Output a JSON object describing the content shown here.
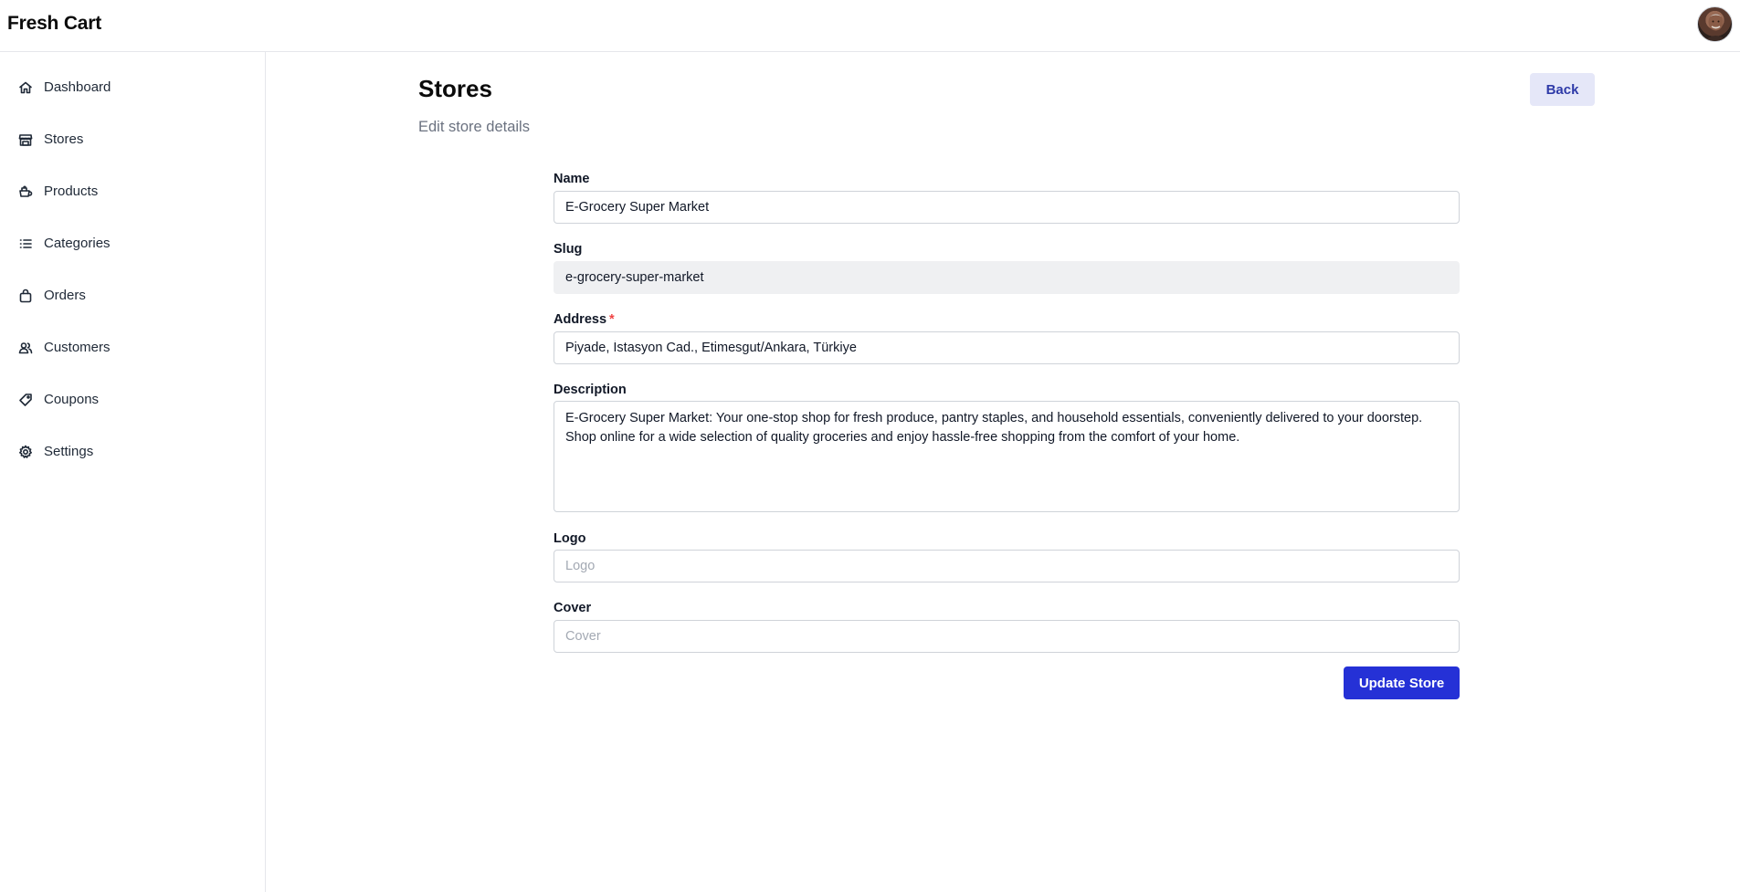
{
  "app": {
    "brand": "Fresh Cart"
  },
  "sidebar": {
    "items": [
      {
        "label": "Dashboard",
        "icon": "home-icon"
      },
      {
        "label": "Stores",
        "icon": "store-icon"
      },
      {
        "label": "Products",
        "icon": "products-icon"
      },
      {
        "label": "Categories",
        "icon": "list-icon"
      },
      {
        "label": "Orders",
        "icon": "shopping-bag-icon"
      },
      {
        "label": "Customers",
        "icon": "users-icon"
      },
      {
        "label": "Coupons",
        "icon": "tag-icon"
      },
      {
        "label": "Settings",
        "icon": "gear-icon"
      }
    ]
  },
  "header": {
    "title": "Stores",
    "subtitle": "Edit store details",
    "back_label": "Back"
  },
  "form": {
    "name": {
      "label": "Name",
      "value": "E-Grocery Super Market"
    },
    "slug": {
      "label": "Slug",
      "value": "e-grocery-super-market"
    },
    "address": {
      "label": "Address",
      "required_mark": "*",
      "value": "Piyade, İstasyon Cad., Etimesgut/Ankara, Türkiye"
    },
    "description": {
      "label": "Description",
      "value": "E-Grocery Super Market: Your one-stop shop for fresh produce, pantry staples, and household essentials, conveniently delivered to your doorstep. Shop online for a wide selection of quality groceries and enjoy hassle-free shopping from the comfort of your home."
    },
    "logo": {
      "label": "Logo",
      "value": "",
      "placeholder": "Logo"
    },
    "cover": {
      "label": "Cover",
      "value": "",
      "placeholder": "Cover"
    },
    "submit_label": "Update Store"
  },
  "colors": {
    "primary": "#2531d6",
    "back_button_bg": "#e5e7f8",
    "required": "#ef4444"
  }
}
